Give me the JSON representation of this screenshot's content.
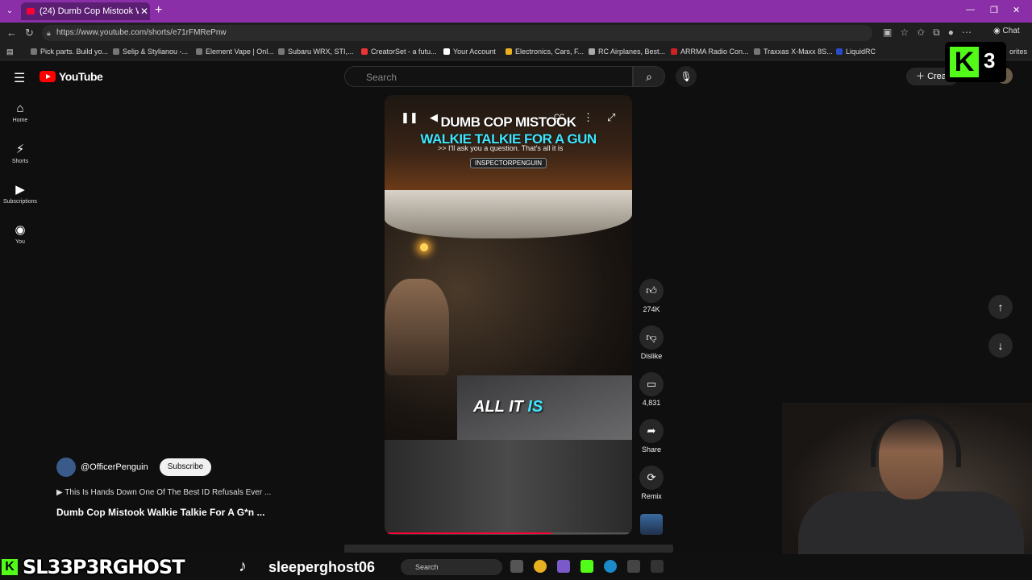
{
  "browser": {
    "tab_title": "(24) Dumb Cop Mistook Walk",
    "url": "https://www.youtube.com/shorts/e71rFMRePnw",
    "chat_label": "Chat",
    "bookmarks": [
      "Pick parts. Build yo...",
      "Selip & Stylianou -...",
      "Element Vape | Onl...",
      "Subaru WRX, STI,...",
      "CreatorSet - a futu...",
      "Your Account",
      "Electronics, Cars, F...",
      "RC Airplanes, Best...",
      "ARRMA Radio Con...",
      "Traxxas X-Maxx 8S...",
      "LiquidRC",
      "orites"
    ]
  },
  "youtube": {
    "logo_text": "YouTube",
    "search_placeholder": "Search",
    "create_label": "Creat",
    "sidebar": [
      {
        "label": "Home",
        "icon": "home-icon"
      },
      {
        "label": "Shorts",
        "icon": "shorts-icon"
      },
      {
        "label": "Subscriptions",
        "icon": "subscriptions-icon"
      },
      {
        "label": "You",
        "icon": "you-icon"
      }
    ]
  },
  "kick_overlay": {
    "count": "3"
  },
  "video": {
    "title_line1": "DUMB COP MISTOOK",
    "title_line2": "WALKIE TALKIE FOR A GUN",
    "caption": ">> I'll ask you a question. That's all it is",
    "channel_tag": "INSPECTORPENGUIN",
    "subtitle_main": "ALL IT ",
    "subtitle_accent": "IS",
    "progress": 0.68
  },
  "actions": {
    "like_count": "274K",
    "dislike_label": "Dislike",
    "comments_count": "4,831",
    "share_label": "Share",
    "remix_label": "Remix"
  },
  "meta": {
    "channel": "@OfficerPenguin",
    "subscribe_label": "Subscribe",
    "description": "▶ This Is Hands Down One Of The Best ID Refusals Ever ...",
    "title": "Dumb Cop Mistook Walkie Talkie For A G*n ..."
  },
  "stream_overlay": {
    "kick_handle": "SL33P3RGHOST",
    "tiktok_handle": "sleeperghost06"
  },
  "taskbar": {
    "search_label": "Search"
  }
}
